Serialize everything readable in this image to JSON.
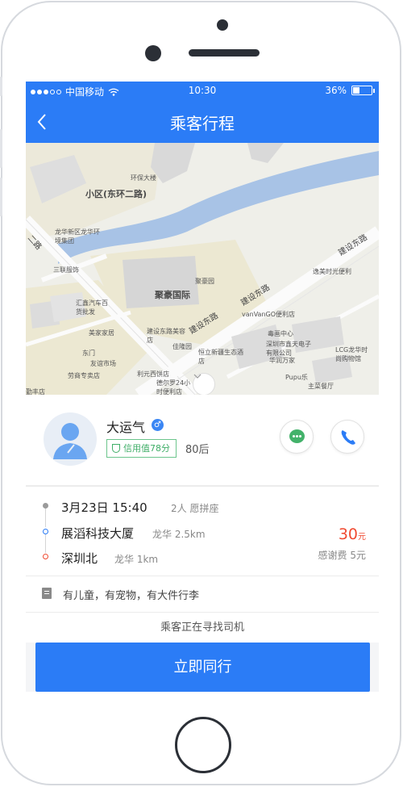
{
  "status_bar": {
    "carrier": "中国移动",
    "time": "10:30",
    "battery": "36%"
  },
  "nav": {
    "back_icon": "chevron-left-icon",
    "title": "乘客行程"
  },
  "map": {
    "labels": {
      "district": "小区(东环二路)",
      "building": "聚豪国际",
      "road_jianshe_e": "建设东路",
      "road_jianshe_e2": "建设东路",
      "road_jianshe_e3": "建设东路",
      "road_ring2": "二路",
      "poi_1": "环保大楼",
      "poi_2": "龙华新区龙华环境集团",
      "poi_3": "三联服饰",
      "poi_4": "汇鑫汽车百货批发",
      "poi_5": "美家家居",
      "poi_6": "建设东路美容店",
      "poi_7": "佳隆园",
      "poi_8": "恒立新疆生态酒店",
      "poi_9": "利元西饼店",
      "poi_10": "德尔罗24小时便利店",
      "poi_11": "东门",
      "poi_12": "友谊市场",
      "poi_13": "劳商专卖店",
      "poi_14": "聚豪园",
      "poi_15": "vanVanGO便利店",
      "poi_16": "毒画中心",
      "poi_17": "深圳市鑫天电子有限公司",
      "poi_18": "华润万家",
      "poi_19": "LCG龙华时尚购物馆",
      "poi_20": "Pupu乐",
      "poi_21": "主菜餐厅",
      "poi_22": "逸美时光便利",
      "poi_23": "勤丰店"
    },
    "expand_icon": "chevron-down-icon"
  },
  "passenger": {
    "name": "大运气",
    "gender_icon": "male-icon",
    "gender_symbol": "♂",
    "credit": "信用值78分",
    "age_group": "80后",
    "chat_icon": "chat-bubble-icon",
    "call_icon": "phone-icon"
  },
  "trip": {
    "date": "3月23日",
    "time": "15:40",
    "seats": "2人 愿拼座",
    "from": "展滔科技大厦",
    "from_area": "龙华",
    "from_distance": "2.5km",
    "to": "深圳北",
    "to_area": "龙华",
    "to_distance": "1km",
    "price": "30",
    "price_unit": "元",
    "thanks_label": "感谢费",
    "thanks_value": "5元"
  },
  "note": {
    "icon": "note-icon",
    "text": "有儿童，有宠物，有大件行李"
  },
  "status_text": "乘客正在寻找司机",
  "cta": "立即同行",
  "colors": {
    "primary": "#2b7cf6",
    "price": "#f04b32",
    "credit": "#3fae67",
    "chat": "#43b26a"
  }
}
